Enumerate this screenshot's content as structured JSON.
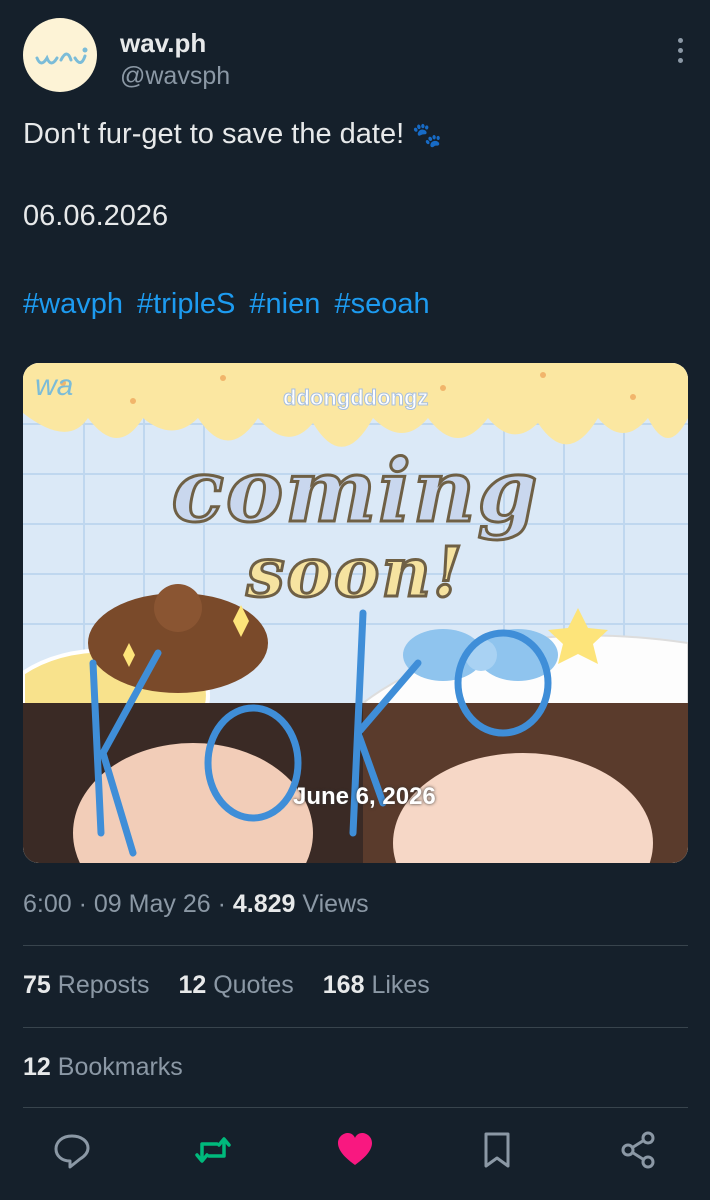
{
  "author": {
    "name": "wav.ph",
    "handle": "@wavsph",
    "avatar_icon": "wav-logo-icon"
  },
  "tweet": {
    "text": "Don't fur-get to save the date!",
    "emoji": "🐾",
    "date": "06.06.2026",
    "hashtags": [
      "#wavph",
      "#tripleS",
      "#nien",
      "#seoah"
    ]
  },
  "media": {
    "watermark": "wa",
    "brand": "ddongddongz",
    "headline_1": "coming",
    "headline_2": "soon!",
    "overlay_scribble": "KOKO",
    "date_caption": "June 6, 2026"
  },
  "meta": {
    "time": "6:00",
    "sep": "·",
    "date": "09 May 26",
    "views_count": "4.829",
    "views_label": "Views"
  },
  "stats": {
    "reposts_count": "75",
    "reposts_label": "Reposts",
    "quotes_count": "12",
    "quotes_label": "Quotes",
    "likes_count": "168",
    "likes_label": "Likes",
    "bookmarks_count": "12",
    "bookmarks_label": "Bookmarks"
  },
  "actions": [
    "reply-icon",
    "repost-icon",
    "like-icon",
    "bookmark-icon",
    "share-icon"
  ],
  "colors": {
    "background": "#15202b",
    "link": "#1d9bf0",
    "repost_active": "#00ba7c",
    "like_active": "#f91880",
    "muted": "#8b98a5"
  }
}
